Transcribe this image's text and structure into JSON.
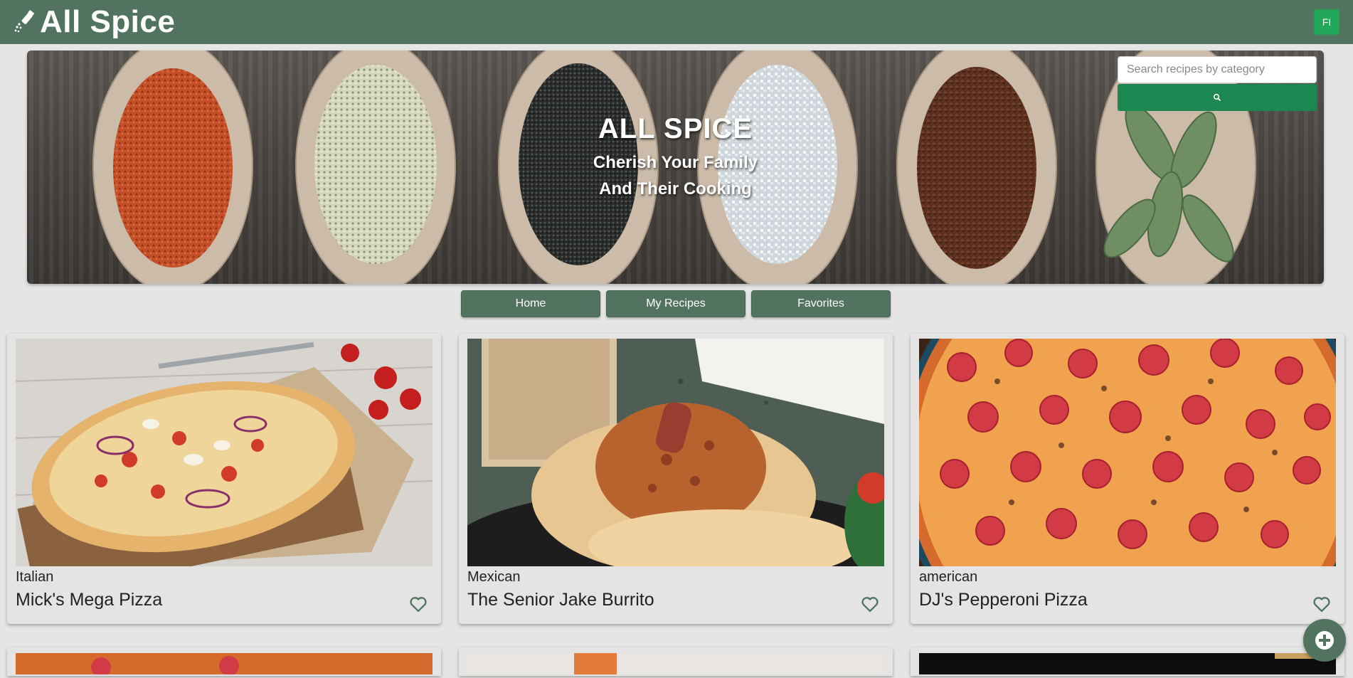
{
  "navbar": {
    "brand": "All Spice",
    "avatar_initials": "FI",
    "icons": {
      "brand": "spice-grinder-icon"
    }
  },
  "hero": {
    "title": "ALL SPICE",
    "subtitle_line1": "Cherish Your Family",
    "subtitle_line2": "And Their Cooking",
    "search": {
      "placeholder": "Search recipes by category",
      "button_icon": "search-icon"
    }
  },
  "nav": {
    "home": "Home",
    "my_recipes": "My Recipes",
    "favorites": "Favorites"
  },
  "recipes": [
    {
      "category": "Italian",
      "title": "Mick's Mega Pizza",
      "image": "pizza-photo",
      "favorite_icon": "heart-outline-icon"
    },
    {
      "category": "Mexican",
      "title": "The Senior Jake Burrito",
      "image": "burrito-photo",
      "favorite_icon": "heart-outline-icon"
    },
    {
      "category": "american",
      "title": "DJ's Pepperoni Pizza",
      "image": "pepperoni-pizza-photo",
      "favorite_icon": "heart-outline-icon"
    }
  ],
  "fab": {
    "icon": "plus-circle-icon"
  },
  "colors": {
    "navbar": "#52735f",
    "button": "#52735f",
    "search_button": "#1d8752",
    "avatar": "#22a85a",
    "background": "#e5e5e5"
  }
}
